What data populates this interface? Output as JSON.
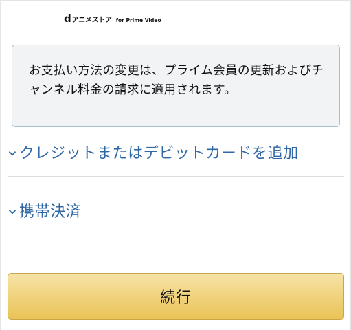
{
  "header": {
    "brand_d": "d",
    "brand_name": "アニメストア",
    "brand_sub": "for Prime Video"
  },
  "notice": {
    "text": "お支払い方法の変更は、プライム会員の更新およびチャンネル料金の請求に適用されます。"
  },
  "payment_options": [
    {
      "label": "クレジットまたはデビットカードを追加",
      "icon": "chevron-down-icon"
    },
    {
      "label": "携帯決済",
      "icon": "chevron-down-icon"
    }
  ],
  "actions": {
    "continue_label": "続行"
  },
  "colors": {
    "link": "#2f68a5",
    "notice_bg": "#f1f3f5",
    "notice_border": "#a6bfcf",
    "button_top": "#f7e3a7",
    "button_bottom": "#eac356"
  }
}
